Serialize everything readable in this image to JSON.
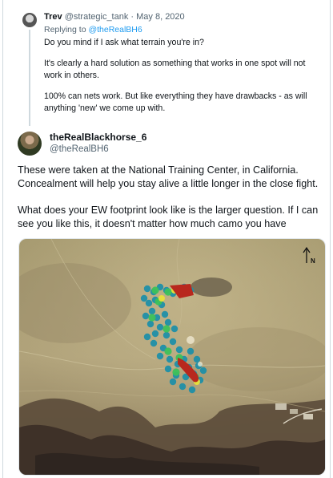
{
  "quoted": {
    "name": "Trev",
    "meta": "@strategic_tank · May 8, 2020",
    "replying_prefix": "Replying to",
    "replying_to": "@theRealBH6",
    "paragraphs": [
      "Do you mind if I ask what terrain you're in?",
      "It's clearly a hard solution as something that works in one spot will not work in others.",
      "100% can nets work. But like everything they have drawbacks - as will anything 'new' we come up with."
    ]
  },
  "tweet": {
    "name": "theRealBlackhorse_6",
    "handle": "@theRealBH6",
    "paragraphs": [
      "These were taken at the National Training Center, in California. Concealment will help you stay alive a little longer in the close fight.",
      "What does your EW footprint look like is the larger question.  If I can see you like this, it doesn't matter how much camo you have"
    ]
  },
  "image": {
    "north_label": "N",
    "colors": {
      "ground": "#a79a73",
      "heat_low": "#1f8fa8",
      "heat_mid": "#3cc15a",
      "heat_high": "#e8e23a",
      "heat_max": "#b8281e"
    }
  }
}
